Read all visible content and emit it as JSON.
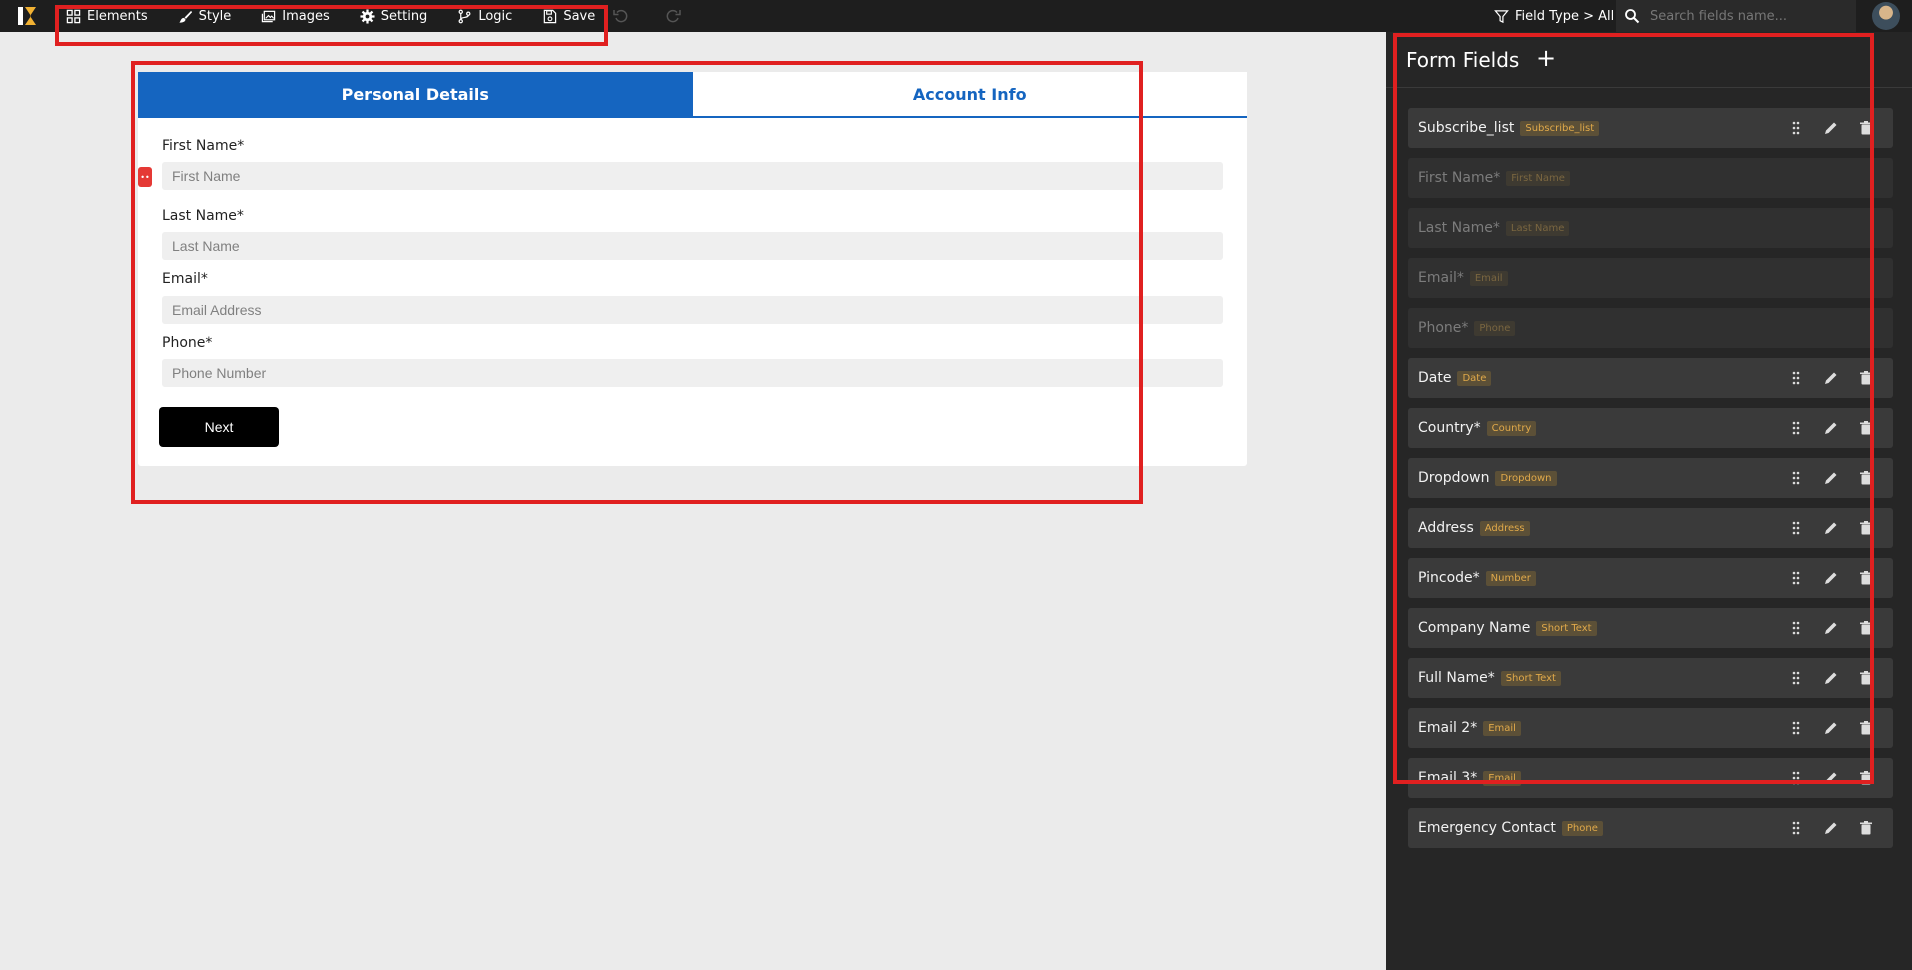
{
  "toolbar": {
    "items": [
      {
        "label": "Elements",
        "icon": "grid-icon"
      },
      {
        "label": "Style",
        "icon": "brush-icon"
      },
      {
        "label": "Images",
        "icon": "image-icon"
      },
      {
        "label": "Setting",
        "icon": "gear-icon"
      },
      {
        "label": "Logic",
        "icon": "branch-icon"
      },
      {
        "label": "Save",
        "icon": "save-icon"
      }
    ],
    "filter_label": "Field Type > All",
    "search_placeholder": "Search fields name..."
  },
  "form": {
    "tabs": [
      {
        "label": "Personal Details",
        "active": true
      },
      {
        "label": "Account Info",
        "active": false
      }
    ],
    "fields": [
      {
        "label": "First Name*",
        "placeholder": "First Name"
      },
      {
        "label": "Last Name*",
        "placeholder": "Last Name"
      },
      {
        "label": "Email*",
        "placeholder": "Email Address"
      },
      {
        "label": "Phone*",
        "placeholder": "Phone Number"
      }
    ],
    "next_label": "Next",
    "drag_handle": "••"
  },
  "panel": {
    "title": "Form Fields",
    "add_label": "+",
    "fields": [
      {
        "name": "Subscribe_list",
        "tag": "Subscribe_list",
        "disabled": false
      },
      {
        "name": "First Name*",
        "tag": "First Name",
        "disabled": true
      },
      {
        "name": "Last Name*",
        "tag": "Last Name",
        "disabled": true
      },
      {
        "name": "Email*",
        "tag": "Email",
        "disabled": true
      },
      {
        "name": "Phone*",
        "tag": "Phone",
        "disabled": true
      },
      {
        "name": "Date",
        "tag": "Date",
        "disabled": false
      },
      {
        "name": "Country*",
        "tag": "Country",
        "disabled": false
      },
      {
        "name": "Dropdown",
        "tag": "Dropdown",
        "disabled": false
      },
      {
        "name": "Address",
        "tag": "Address",
        "disabled": false
      },
      {
        "name": "Pincode*",
        "tag": "Number",
        "disabled": false
      },
      {
        "name": "Company Name",
        "tag": "Short Text",
        "disabled": false
      },
      {
        "name": "Full Name*",
        "tag": "Short Text",
        "disabled": false
      },
      {
        "name": "Email 2*",
        "tag": "Email",
        "disabled": false
      },
      {
        "name": "Email 3*",
        "tag": "Email",
        "disabled": false
      },
      {
        "name": "Emergency Contact",
        "tag": "Phone",
        "disabled": false
      }
    ]
  },
  "colors": {
    "accent": "#1565c0",
    "annotation": "#e02020",
    "tag_text": "#e0a94a",
    "panel_bg": "#262626"
  }
}
